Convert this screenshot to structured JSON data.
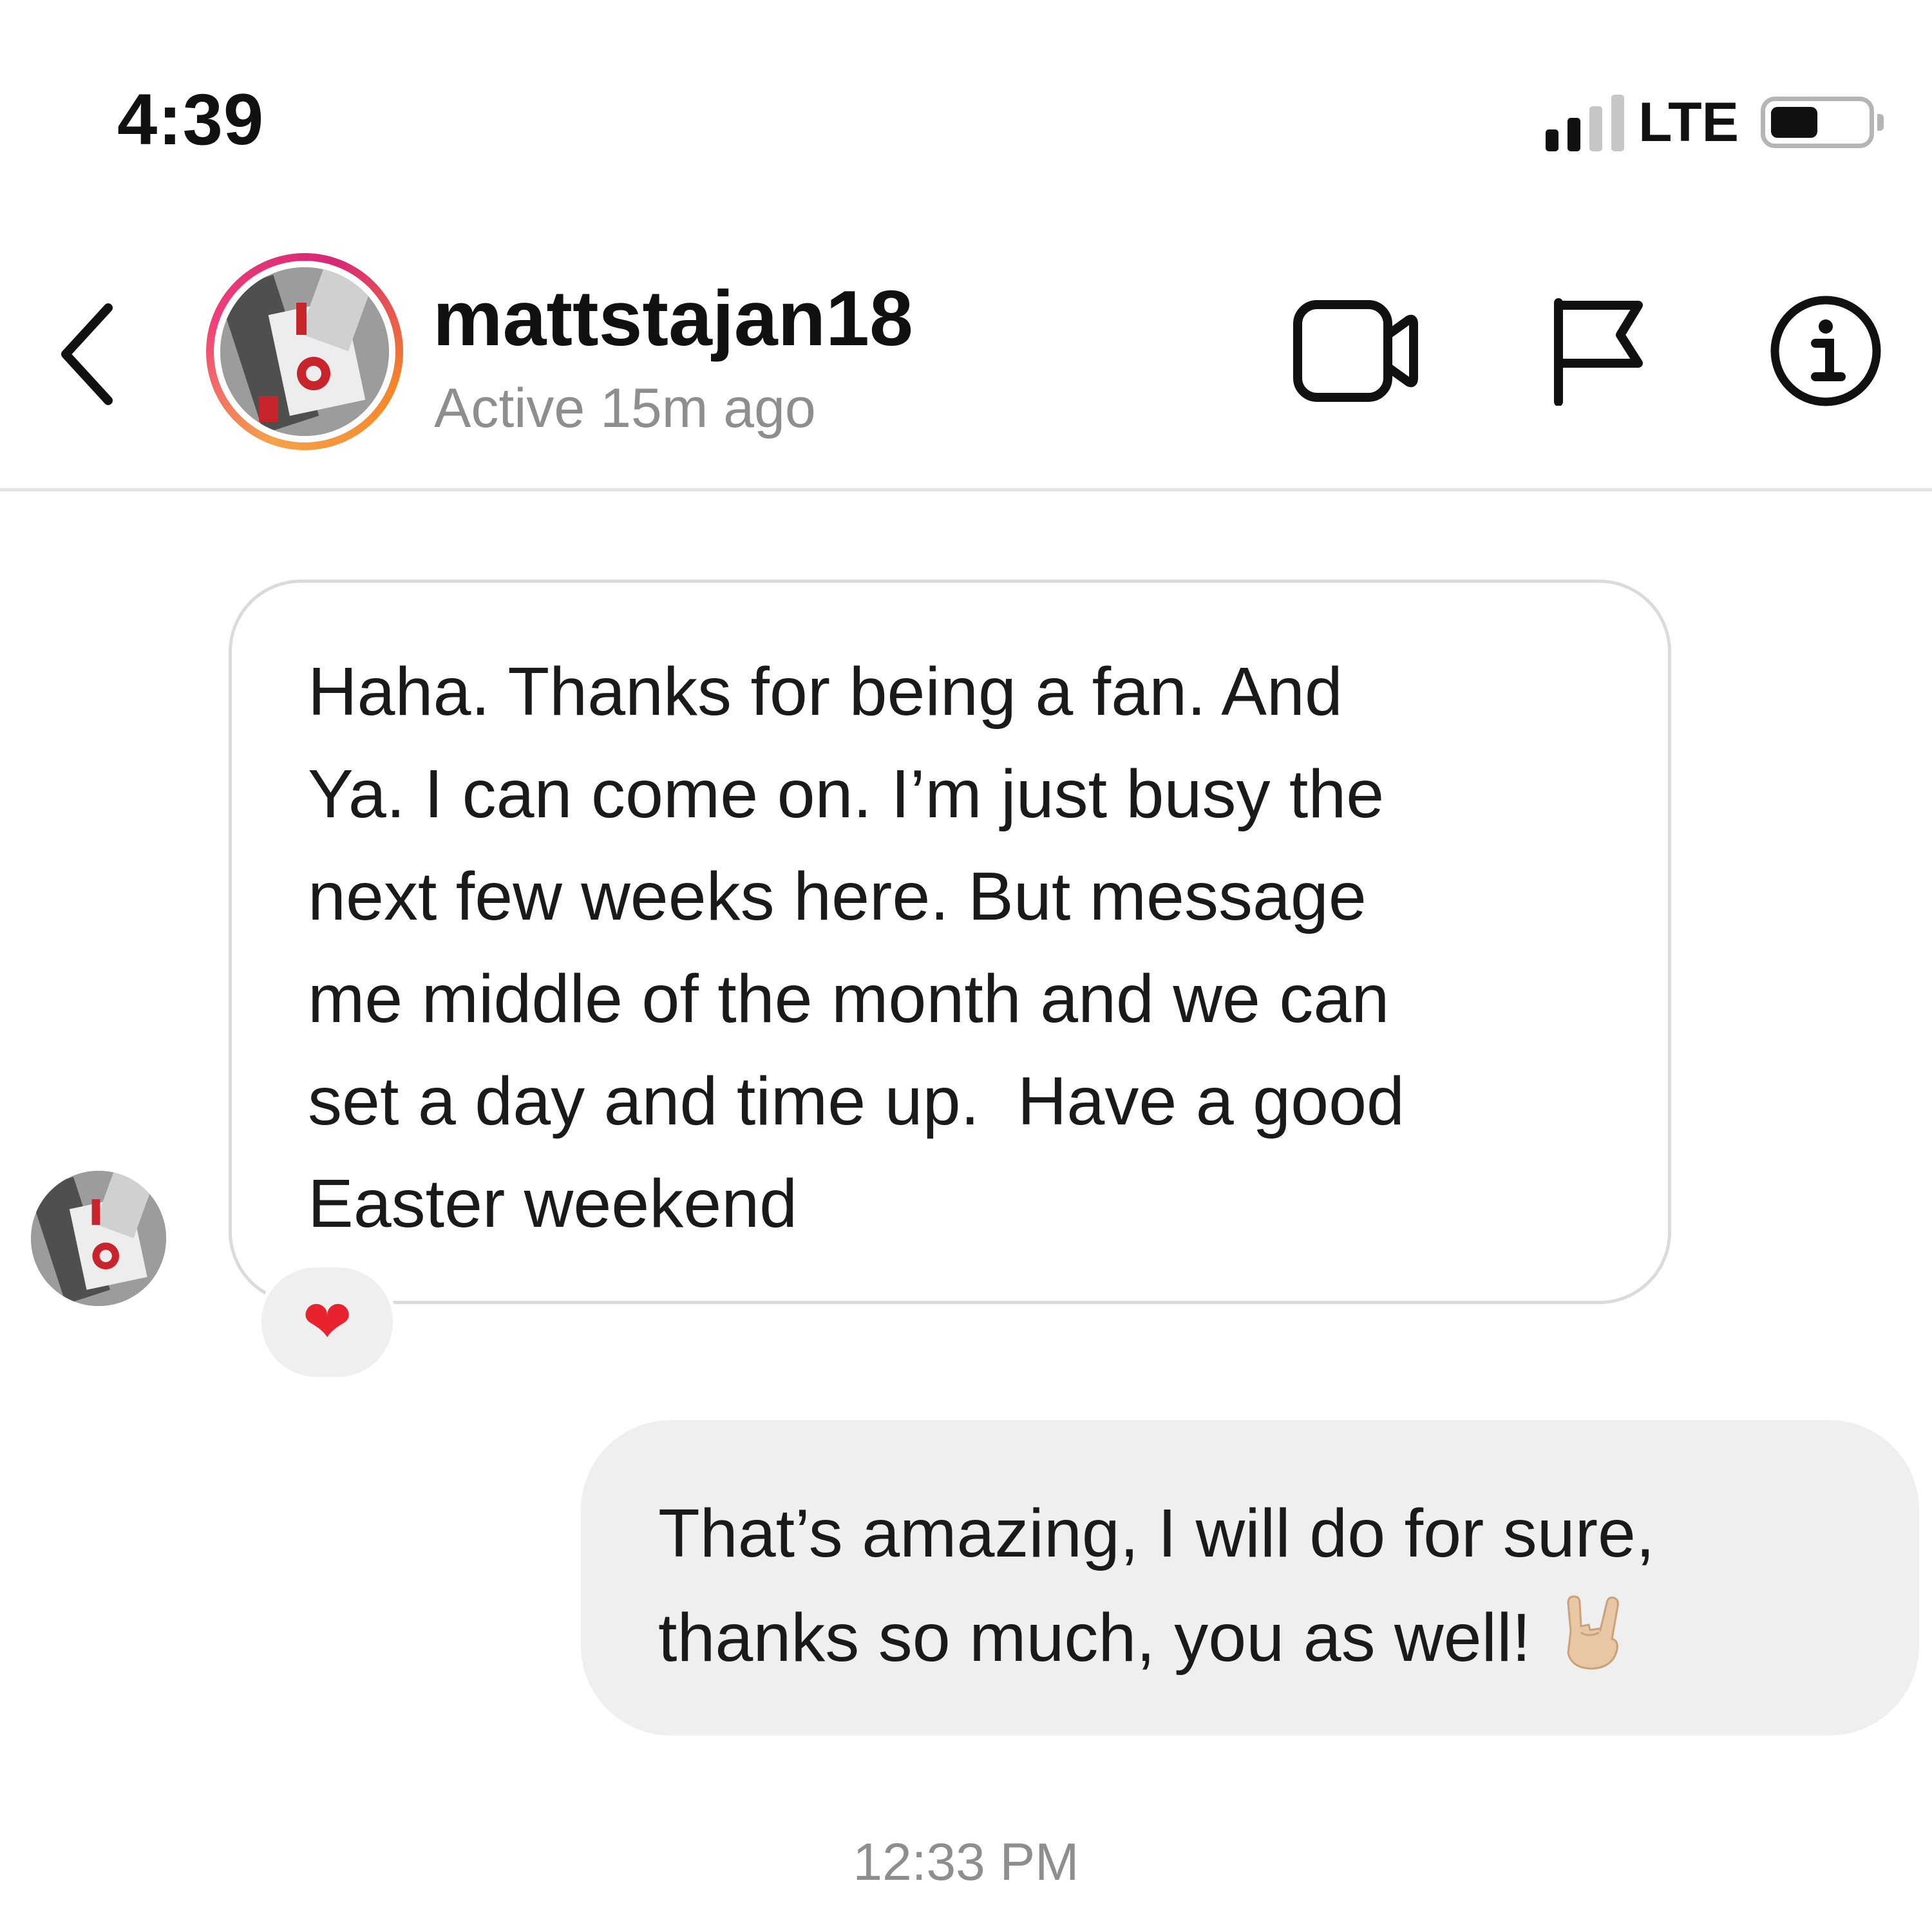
{
  "status_bar": {
    "time": "4:39",
    "network": "LTE",
    "signal_bars_filled": 2,
    "signal_bars_total": 4,
    "battery_level": 0.45
  },
  "header": {
    "username": "mattstajan18",
    "active_status": "Active 15m ago",
    "icons": [
      "back-chevron-icon",
      "video-camera-icon",
      "flag-icon",
      "info-icon"
    ]
  },
  "messages": [
    {
      "direction": "incoming",
      "text": "Haha. Thanks for being a fan. And\nYa. I can come on. I’m just busy the\nnext few weeks here. But message\nme middle of the month and we can\nset a day and time up.  Have a good\nEaster weekend",
      "reaction": "❤"
    },
    {
      "direction": "outgoing",
      "text": "That’s amazing, I will do for sure,\nthanks so much, you as well!",
      "emoji": "rock-on-hand-icon"
    }
  ],
  "timestamp": "12:33 PM",
  "colors": {
    "background": "#ffffff",
    "text": "#111111",
    "secondary_text": "#8e8e8e",
    "bubble_border": "#dbdbdb",
    "outgoing_bubble": "#efefef",
    "reaction_heart": "#e8222e",
    "story_ring_start": "#f58529",
    "story_ring_end": "#d62976"
  }
}
